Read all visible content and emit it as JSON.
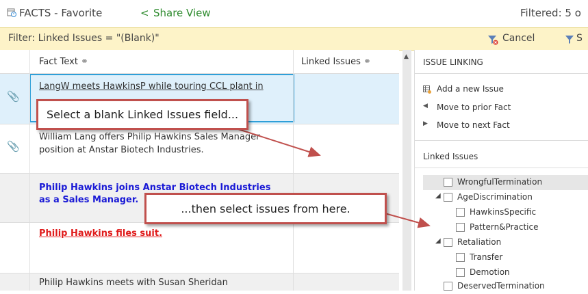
{
  "header": {
    "title": "FACTS - Favorite",
    "share_label": "Share View",
    "filtered_text": "Filtered: 5 o"
  },
  "filter": {
    "text": "Filter:  Linked Issues = \"(Blank)\"",
    "cancel_label": "Cancel",
    "save_label": "S"
  },
  "grid": {
    "columns": [
      "Fact Text",
      "Linked Issues"
    ],
    "rows": [
      {
        "text": "LangW meets HawkinsP while touring CCL plant in",
        "text2": "",
        "attachment": true,
        "selected": true
      },
      {
        "text": "William Lang offers Philip Hawkins Sales Manager",
        "text2": "position at Anstar Biotech Industries.",
        "attachment": true
      },
      {
        "text": "Philip Hawkins joins Anstar Biotech Industries",
        "text2": "as a Sales Manager.",
        "attachment": false
      },
      {
        "text": "Philip Hawkins files suit.",
        "text2": "",
        "attachment": false
      },
      {
        "text": "Philip Hawkins meets with Susan Sheridan",
        "text2": "",
        "attachment": false
      }
    ]
  },
  "panel": {
    "title": "ISSUE LINKING",
    "actions": [
      "Add a new Issue",
      "Move to prior Fact",
      "Move to next Fact"
    ],
    "linked_title": "Linked Issues",
    "tree": [
      {
        "label": "WrongfulTermination",
        "level": 0,
        "expander": false,
        "highlight": true
      },
      {
        "label": "AgeDiscrimination",
        "level": 0,
        "expander": true
      },
      {
        "label": "HawkinsSpecific",
        "level": 1,
        "expander": false
      },
      {
        "label": "Pattern&Practice",
        "level": 1,
        "expander": false
      },
      {
        "label": "Retaliation",
        "level": 0,
        "expander": true
      },
      {
        "label": "Transfer",
        "level": 1,
        "expander": false
      },
      {
        "label": "Demotion",
        "level": 1,
        "expander": false
      },
      {
        "label": "DeservedTermination",
        "level": 0,
        "expander": false
      }
    ]
  },
  "callouts": {
    "first": "Select a blank Linked Issues field...",
    "second": "...then select issues from here."
  },
  "colors": {
    "accent_green": "#2e8b2e",
    "filter_bg": "#fdf3c8",
    "callout_border": "#c0504d",
    "link_blue": "#1a1ad6",
    "link_red": "#e01b1b",
    "selected_row": "#dff0fb"
  }
}
